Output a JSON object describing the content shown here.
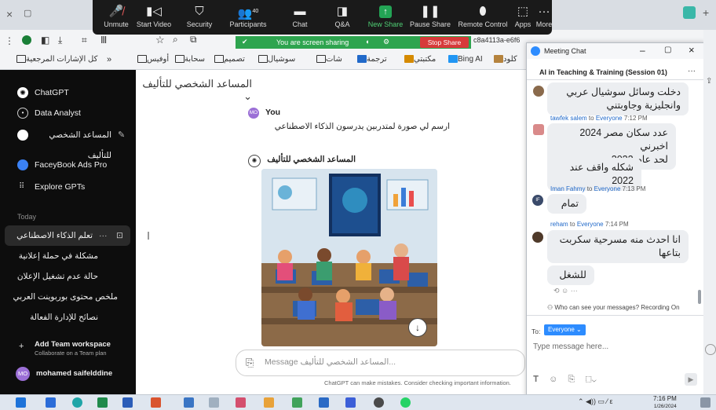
{
  "zoom_toolbar": {
    "unmute": "Unmute",
    "start_video": "Start Video",
    "security": "Security",
    "participants": "Participants",
    "participants_count": "40",
    "chat": "Chat",
    "qa": "Q&A",
    "new_share": "New Share",
    "pause_share": "Pause Share",
    "remote_control": "Remote Control",
    "apps": "Apps",
    "more": "More"
  },
  "share_bar": {
    "status": "You are screen sharing",
    "stop": "Stop Share"
  },
  "browser": {
    "url_fragment": "c8a4113a-e6f6"
  },
  "bookmarks": [
    {
      "label": "كل الإشارات المرجعية"
    },
    {
      "label": "أوفيس"
    },
    {
      "label": "سحابة"
    },
    {
      "label": "تصميم"
    },
    {
      "label": "سوشيال"
    },
    {
      "label": "شات"
    },
    {
      "label": "ترجمة"
    },
    {
      "label": "مكتبتي"
    },
    {
      "label": "Bing AI"
    },
    {
      "label": "كلود"
    }
  ],
  "sidebar": {
    "chatgpt": "ChatGPT",
    "data_analyst": "Data Analyst",
    "author_assistant": "المساعد الشخصي للتأليف",
    "faceybook": "FaceyBook Ads Pro",
    "explore": "Explore GPTs",
    "today": "Today",
    "history": [
      "تعلم الذكاء الاصطناعي",
      "مشكلة في حملة إعلانية",
      "حالة عدم تشغيل الإعلان",
      "ملخص محتوى بوربوينت العربي",
      "نصائح للإدارة الفعالة"
    ],
    "team_title": "Add Team workspace",
    "team_sub": "Collaborate on a Team plan",
    "user_initials": "MO",
    "user_name": "mohamed saifelddine"
  },
  "main": {
    "gpt_title": "المساعد الشخصي للتأليف",
    "you_label": "You",
    "you_initials": "MO",
    "user_message": "ارسم لي صورة لمتدربين يدرسون الذكاء الاصطناعي",
    "assistant_name": "المساعد الشخصي للتأليف",
    "input_placeholder": "Message المساعد الشخصي للتأليف...",
    "disclaimer": "ChatGPT can make mistakes. Consider checking important information."
  },
  "chat_window": {
    "title": "Meeting Chat",
    "meeting_name": "AI in Teaching & Training (Session 01)",
    "messages": [
      {
        "sender": "",
        "to": "",
        "time": "",
        "lines": [
          "دخلت وسائل سوشيال عربي",
          "وانجليزية وجاوبتني"
        ]
      },
      {
        "sender": "tawfek salem",
        "to": "Everyone",
        "time": "7:12 PM",
        "lines": [
          "عدد سكان مصر 2024 اخبرني",
          "لحد عام 2022"
        ]
      },
      {
        "sender": "",
        "to": "",
        "time": "",
        "lines": [
          "شكله واقف عند 2022"
        ]
      },
      {
        "sender": "Iman Fahmy",
        "to": "Everyone",
        "time": "7:13 PM",
        "lines": [
          "تمام"
        ]
      },
      {
        "sender": "reham",
        "to": "Everyone",
        "time": "7:14 PM",
        "lines": [
          "انا احدث منه مسرحية سكربت",
          "بتاعها"
        ]
      },
      {
        "sender": "",
        "to": "",
        "time": "",
        "lines": [
          "للشغل"
        ]
      }
    ],
    "iman_initials": "IF",
    "privacy_note": "Who can see your messages? Recording On",
    "to_label": "To:",
    "to_value": "Everyone",
    "input_placeholder": "Type message here..."
  },
  "taskbar": {
    "time": "7:16 PM",
    "date": "1/26/2024"
  }
}
